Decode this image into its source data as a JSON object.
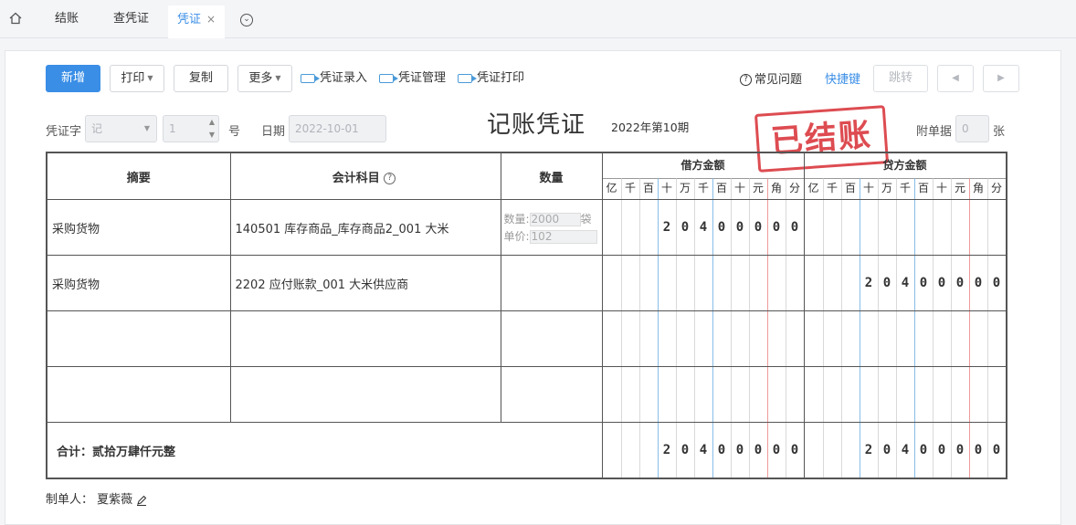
{
  "tabs": [
    {
      "label": "结账"
    },
    {
      "label": "查凭证"
    },
    {
      "label": "凭证",
      "close": "×"
    }
  ],
  "toolbar": {
    "add": "新增",
    "print": "打印",
    "copy": "复制",
    "more": "更多",
    "entry": "凭证录入",
    "manage": "凭证管理",
    "vprint": "凭证打印",
    "faq": "常见问题",
    "shortcut": "快捷键",
    "jump": "跳转",
    "prev": "◀",
    "next": "▶"
  },
  "form": {
    "word_label": "凭证字",
    "word_value": "记",
    "num_value": "1",
    "num_suffix": "号",
    "date_label": "日期",
    "date_value": "2022-10-01",
    "title": "记账凭证",
    "period": "2022年第10期",
    "attach_label": "附单据",
    "attach_value": "0",
    "attach_suffix": "张",
    "stamp": "已结账"
  },
  "table": {
    "h_summary": "摘要",
    "h_subject": "会计科目",
    "h_qty": "数量",
    "h_debit": "借方金额",
    "h_credit": "贷方金额",
    "units": [
      "亿",
      "千",
      "百",
      "十",
      "万",
      "千",
      "百",
      "十",
      "元",
      "角",
      "分"
    ],
    "rows": [
      {
        "summary": "采购货物",
        "subject": "140501 库存商品_库存商品2_001 大米",
        "qty_label": "数量:",
        "qty_value": "2000",
        "qty_unit": "袋",
        "price_label": "单价:",
        "price_value": "102",
        "debit": "20400000",
        "credit": ""
      },
      {
        "summary": "采购货物",
        "subject": "2202 应付账款_001 大米供应商",
        "debit": "",
        "credit": "20400000"
      },
      {
        "summary": "",
        "subject": "",
        "debit": "",
        "credit": ""
      },
      {
        "summary": "",
        "subject": "",
        "debit": "",
        "credit": ""
      }
    ],
    "total_label": "合计：贰拾万肆仟元整",
    "total_debit": "20400000",
    "total_credit": "20400000"
  },
  "footer": {
    "maker_label": "制单人：",
    "maker_name": "夏紫薇"
  },
  "colors": {
    "primary": "#3a8ee6",
    "stamp": "#d9343a"
  }
}
